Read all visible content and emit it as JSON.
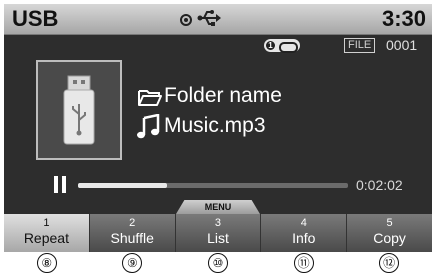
{
  "status_bar": {
    "source": "USB",
    "time": "3:30"
  },
  "info": {
    "file_tag": "FILE",
    "file_number": "0001",
    "repeat_one_mark": "1",
    "folder_name": "Folder name",
    "track_name": "Music.mp3"
  },
  "playback": {
    "elapsed": "0:02:02",
    "progress_fraction": 0.33
  },
  "menu": {
    "tab_label": "MENU",
    "keys": [
      {
        "num": "1",
        "label": "Repeat"
      },
      {
        "num": "2",
        "label": "Shuffle"
      },
      {
        "num": "3",
        "label": "List"
      },
      {
        "num": "4",
        "label": "Info"
      },
      {
        "num": "5",
        "label": "Copy"
      }
    ]
  },
  "callouts": [
    "⑧",
    "⑨",
    "⑩",
    "⑪",
    "⑫"
  ]
}
